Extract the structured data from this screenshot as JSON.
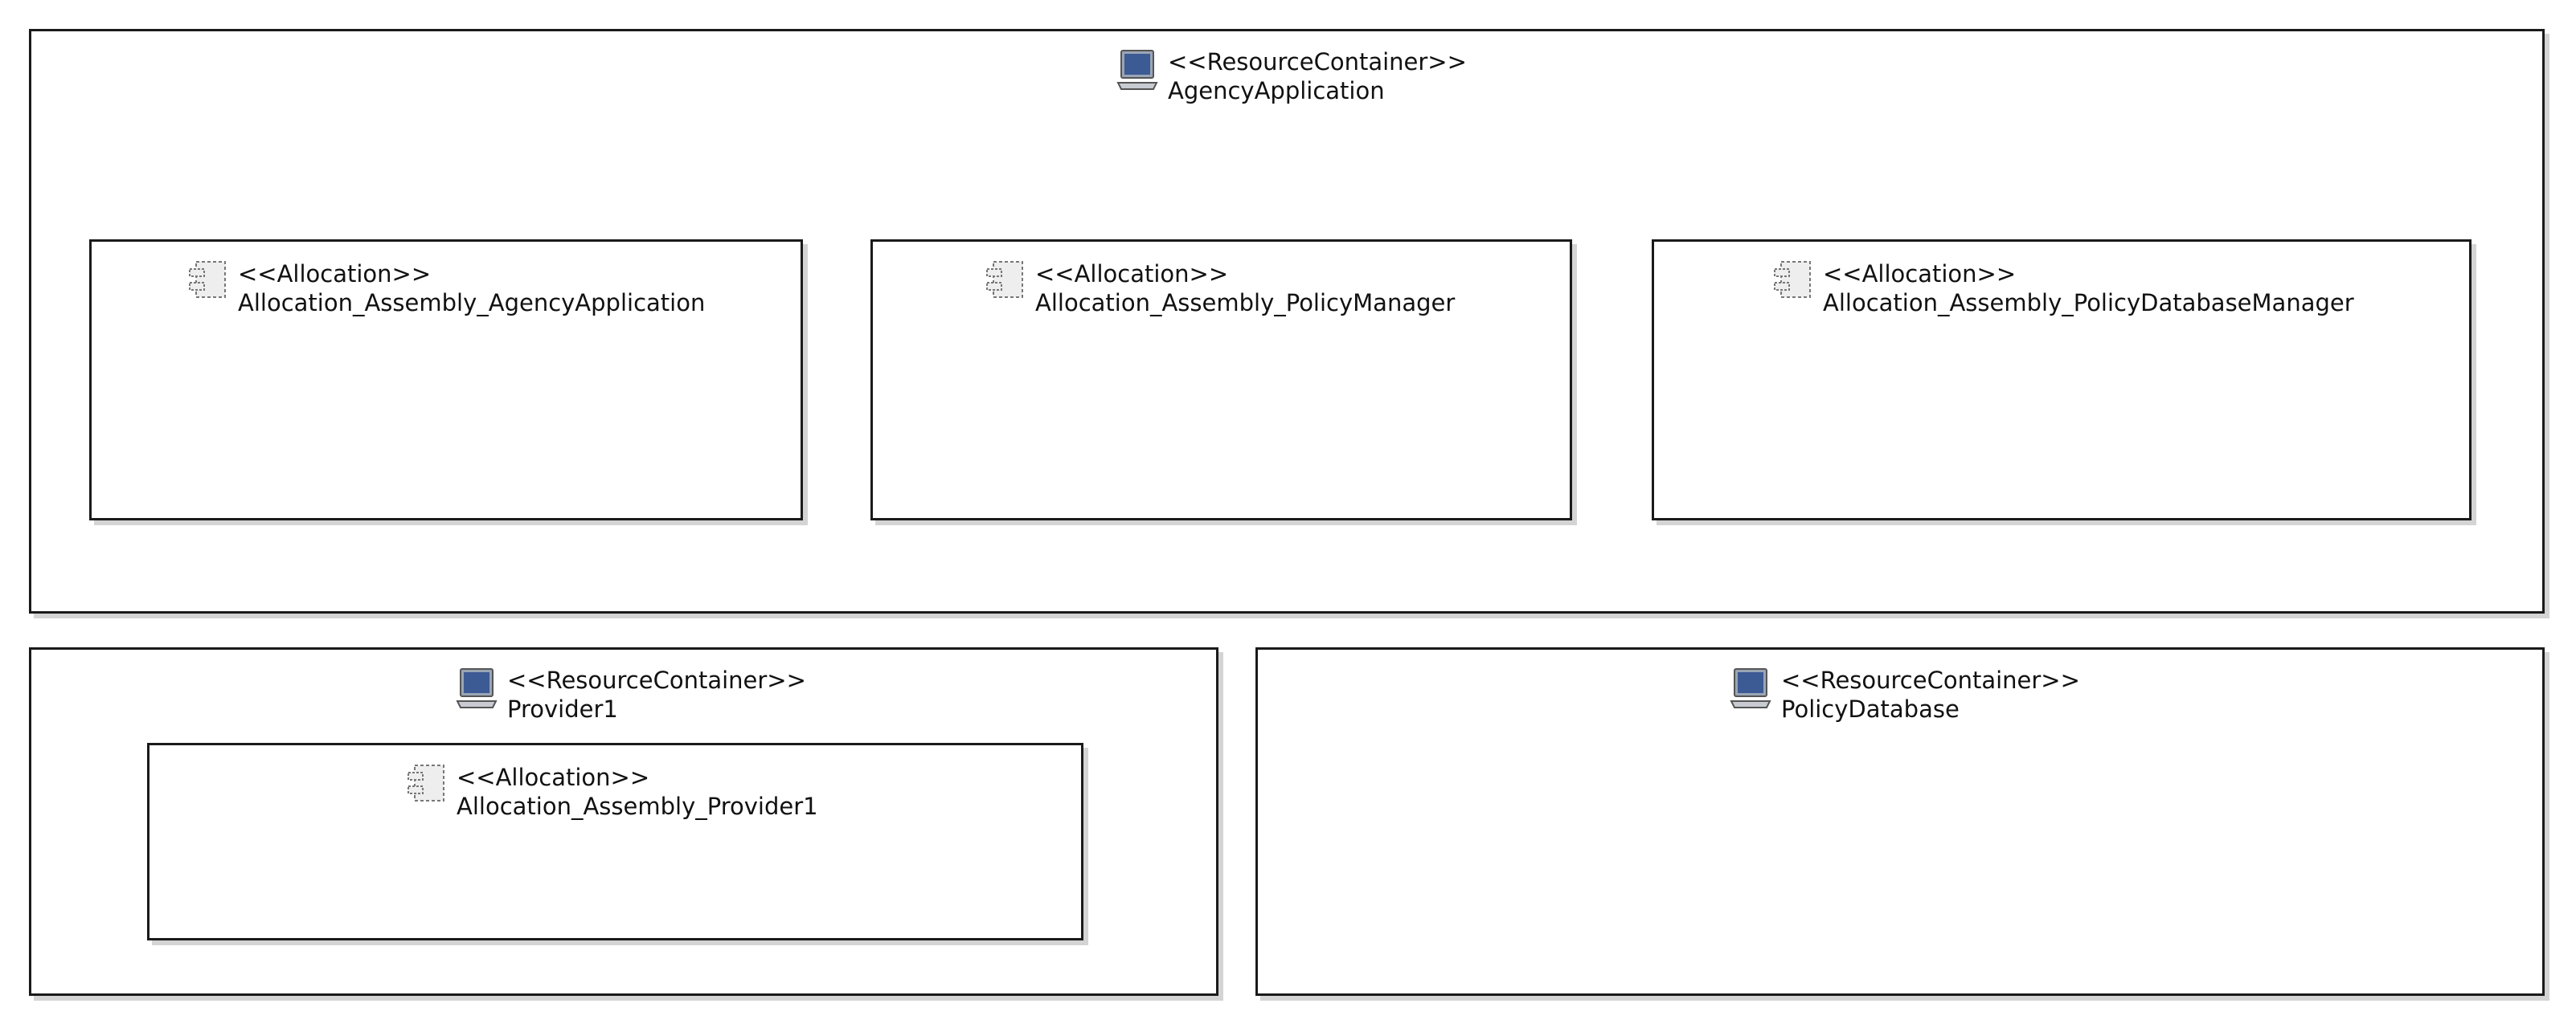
{
  "containers": {
    "agency": {
      "stereotype": "<<ResourceContainer>>",
      "name": "AgencyApplication"
    },
    "provider1": {
      "stereotype": "<<ResourceContainer>>",
      "name": "Provider1"
    },
    "policy_db": {
      "stereotype": "<<ResourceContainer>>",
      "name": "PolicyDatabase"
    }
  },
  "allocations": {
    "agency_app": {
      "stereotype": "<<Allocation>>",
      "name": "Allocation_Assembly_AgencyApplication"
    },
    "policy_manager": {
      "stereotype": "<<Allocation>>",
      "name": "Allocation_Assembly_PolicyManager"
    },
    "policy_db_manager": {
      "stereotype": "<<Allocation>>",
      "name": "Allocation_Assembly_PolicyDatabaseManager"
    },
    "provider1": {
      "stereotype": "<<Allocation>>",
      "name": "Allocation_Assembly_Provider1"
    }
  },
  "icons": {
    "resource_container": "computer-icon",
    "allocation": "component-icon"
  }
}
